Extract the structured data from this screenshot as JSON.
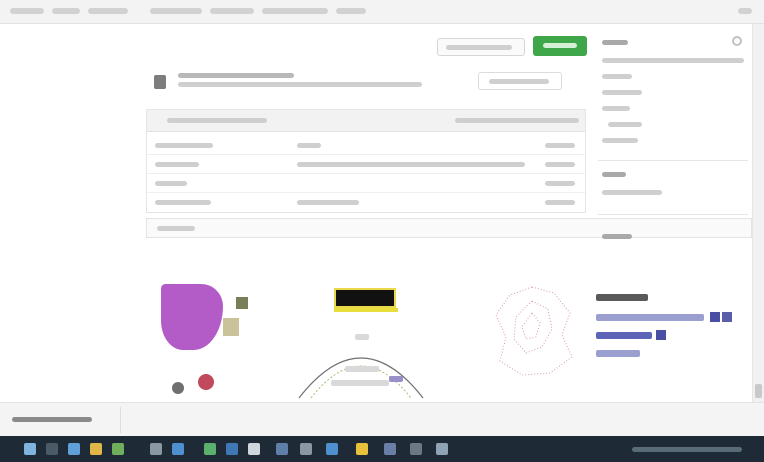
{
  "browser": {
    "address": ""
  },
  "header": {
    "title": "",
    "share_label": "",
    "primary_label": ""
  },
  "file": {
    "name": "",
    "description": "",
    "open_label": ""
  },
  "table": {
    "head_left": "",
    "head_right": "",
    "rows": [
      {
        "name": "",
        "message": "",
        "age": ""
      },
      {
        "name": "",
        "message": "",
        "age": ""
      },
      {
        "name": "",
        "message": "",
        "age": ""
      },
      {
        "name": "",
        "message": "",
        "age": ""
      }
    ]
  },
  "readme": {
    "bar_label": "",
    "heading": ""
  },
  "sidebar": {
    "title": "",
    "items": [
      "",
      "",
      "",
      "",
      "",
      ""
    ],
    "section2": "",
    "section3": ""
  },
  "links": [
    "",
    "",
    "",
    ""
  ],
  "status": {
    "label": ""
  },
  "tray": {
    "text": ""
  },
  "colors": {
    "primary_green": "#3fa64a",
    "taskbar": "#1e2b36",
    "purple": "#b35bc6",
    "link_blue": "#4b4fa3"
  },
  "icons": [
    "file-icon",
    "gear-icon",
    "windows-start-icon",
    "search-icon",
    "folder-icon"
  ]
}
